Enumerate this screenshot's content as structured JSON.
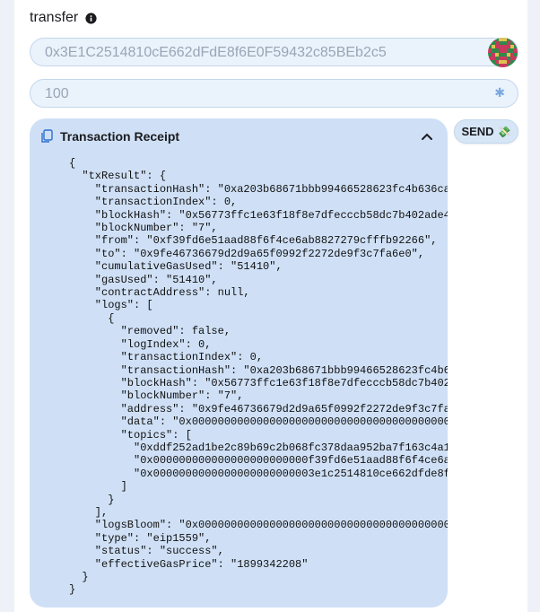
{
  "header": {
    "title": "transfer",
    "info_icon": "info-icon"
  },
  "address_field": {
    "placeholder": "0x3E1C2514810cE662dFdE8f6E0F59432c85BEb2c5",
    "avatar": "blockie-avatar"
  },
  "amount_field": {
    "placeholder": "100",
    "icon": "asterisk-icon"
  },
  "receipt": {
    "title": "Transaction Receipt",
    "copy_icon": "copy-icon",
    "collapse_icon": "chevron-up-icon",
    "json": "{\n  \"txResult\": {\n    \"transactionHash\": \"0xa203b68671bbb99466528623fc4b636cabfd8d5\n    \"transactionIndex\": 0,\n    \"blockHash\": \"0x56773ffc1e63f18f8e7dfecccb58dc7b402ade44b8255\n    \"blockNumber\": \"7\",\n    \"from\": \"0xf39fd6e51aad88f6f4ce6ab8827279cfffb92266\",\n    \"to\": \"0x9fe46736679d2d9a65f0992f2272de9f3c7fa6e0\",\n    \"cumulativeGasUsed\": \"51410\",\n    \"gasUsed\": \"51410\",\n    \"contractAddress\": null,\n    \"logs\": [\n      {\n        \"removed\": false,\n        \"logIndex\": 0,\n        \"transactionIndex\": 0,\n        \"transactionHash\": \"0xa203b68671bbb99466528623fc4b636cabf\n        \"blockHash\": \"0x56773ffc1e63f18f8e7dfecccb58dc7b402ade44b\n        \"blockNumber\": \"7\",\n        \"address\": \"0x9fe46736679d2d9a65f0992f2272de9f3c7fa6e0\",\n        \"data\": \"0x000000000000000000000000000000000000000000000\n        \"topics\": [\n          \"0xddf252ad1be2c89b69c2b068fc378daa952ba7f163c4a11628f5\n          \"0x000000000000000000000000f39fd6e51aad88f6f4ce6ab88272\n          \"0x0000000000000000000000003e1c2514810ce662dfde8f6e0f59\n        ]\n      }\n    ],\n    \"logsBloom\": \"0x000000000000000000000000000000000000000000000\n    \"type\": \"eip1559\",\n    \"status\": \"success\",\n    \"effectiveGasPrice\": \"1899342208\"\n  }\n}"
  },
  "send_button": {
    "label": "SEND",
    "icon": "money-icon"
  },
  "colors": {
    "field_bg": "#eaf2fb",
    "receipt_bg": "#cfe0f6",
    "page_bg": "#eef1f7"
  }
}
